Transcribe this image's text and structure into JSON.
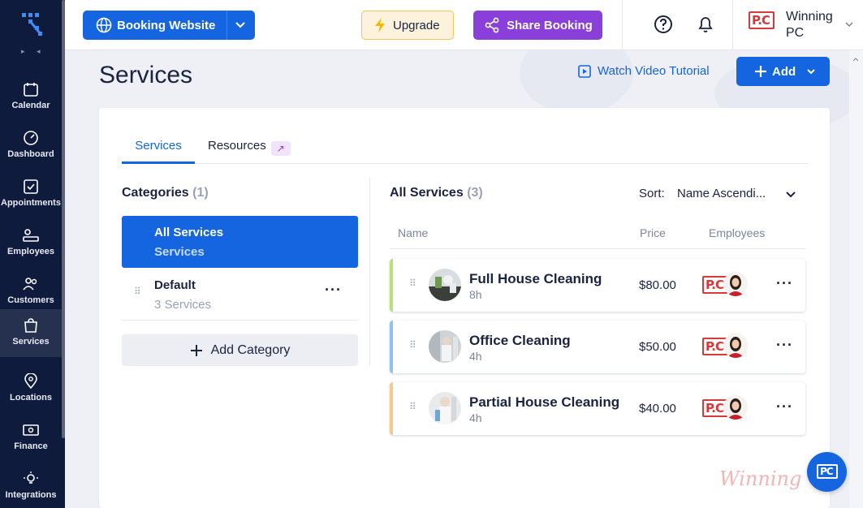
{
  "sidebar": {
    "items": [
      {
        "label": "Calendar",
        "icon": "calendar-icon"
      },
      {
        "label": "Dashboard",
        "icon": "dashboard-icon"
      },
      {
        "label": "Appointments",
        "icon": "appointments-icon"
      },
      {
        "label": "Employees",
        "icon": "employees-icon"
      },
      {
        "label": "Customers",
        "icon": "customers-icon"
      },
      {
        "label": "Services",
        "icon": "services-icon",
        "active": true
      },
      {
        "label": "Locations",
        "icon": "location-icon"
      },
      {
        "label": "Finance",
        "icon": "finance-icon"
      },
      {
        "label": "Integrations",
        "icon": "integrations-icon"
      }
    ]
  },
  "topbar": {
    "booking_label": "Booking Website",
    "upgrade_label": "Upgrade",
    "share_label": "Share Booking",
    "profile_name": "Winning PC",
    "profile_logo": "P.C"
  },
  "header": {
    "title": "Services",
    "watch_label": "Watch Video Tutorial",
    "add_label": "Add"
  },
  "tabs": [
    {
      "label": "Services",
      "active": true
    },
    {
      "label": "Resources",
      "active": false
    }
  ],
  "categories": {
    "heading": "Categories",
    "count": "(1)",
    "items": [
      {
        "name": "All Services",
        "sub": "Services",
        "active": true
      },
      {
        "name": "Default",
        "sub": "3 Services",
        "active": false
      }
    ],
    "add_label": "Add Category"
  },
  "services": {
    "heading": "All Services",
    "count": "(3)",
    "sort_label": "Sort:",
    "sort_value": "Name Ascendi...",
    "columns": [
      "Name",
      "Price",
      "Employees"
    ],
    "rows": [
      {
        "name": "Full House Cleaning",
        "duration": "8h",
        "price": "$80.00",
        "accent": "#b7e07a",
        "emp_logo": "P.C"
      },
      {
        "name": "Office Cleaning",
        "duration": "4h",
        "price": "$50.00",
        "accent": "#8cc4f0",
        "emp_logo": "P.C"
      },
      {
        "name": "Partial House Cleaning",
        "duration": "4h",
        "price": "$40.00",
        "accent": "#f5c98a",
        "emp_logo": "P.C"
      }
    ]
  },
  "watermark": "Winning",
  "colors": {
    "primary": "#1565e0",
    "sidebar": "#0f1b3d",
    "share": "#8a3fdb",
    "upgrade_bg": "#fdf3dc"
  }
}
